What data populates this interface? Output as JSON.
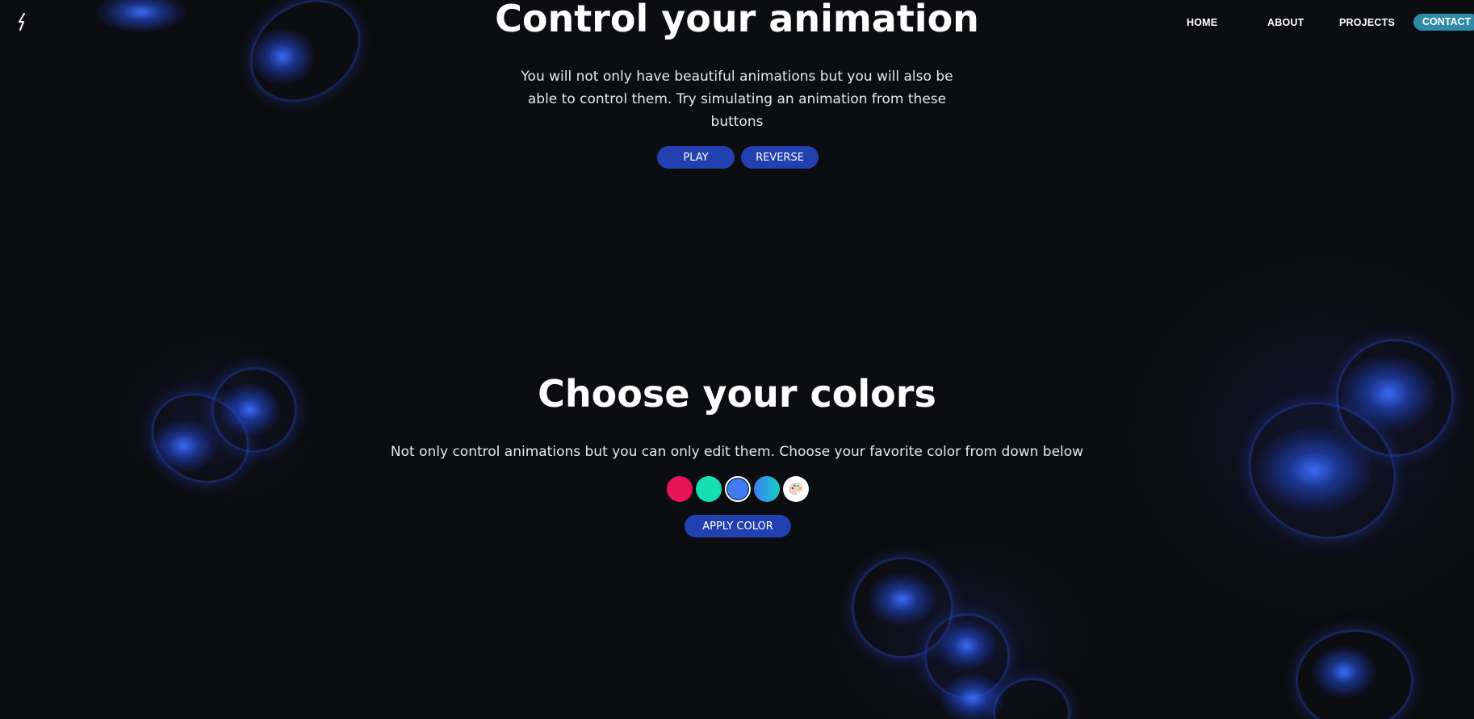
{
  "nav": {
    "links": [
      "HOME",
      "ABOUT",
      "PROJECTS"
    ],
    "contact": "CONTACT"
  },
  "control": {
    "title": "Control your animation",
    "description_lines": [
      "You will not only have beautiful animations but you will also be",
      "able to control them. Try simulating an animation from these",
      "buttons"
    ],
    "play_label": "PLAY",
    "reverse_label": "REVERSE"
  },
  "colors": {
    "title": "Choose your colors",
    "description": "Not only control animations but you can only edit them. Choose your favorite color from down below",
    "swatches": [
      "#e8145a",
      "#14e0b4",
      "#3f7cf2",
      "gradient",
      "custom"
    ],
    "selected_swatch": 2,
    "apply_label": "APPLY COLOR"
  },
  "theme": {
    "accent": "#2240b0",
    "contact_bg": "#2f8aa8",
    "glow": "#3c6eff"
  }
}
